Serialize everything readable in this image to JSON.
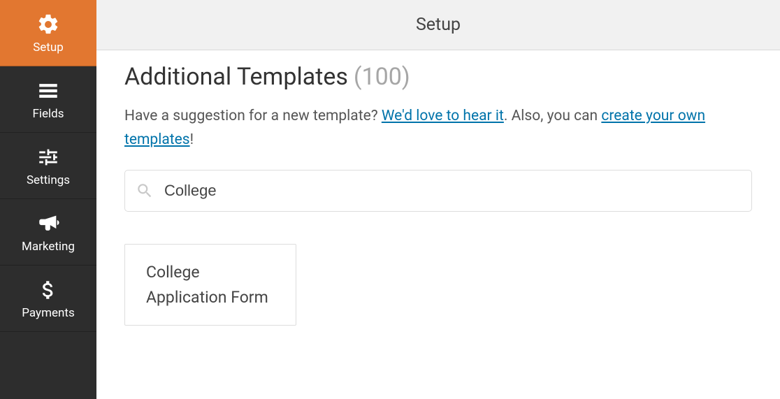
{
  "header": {
    "title": "Setup"
  },
  "sidebar": {
    "items": [
      {
        "label": "Setup"
      },
      {
        "label": "Fields"
      },
      {
        "label": "Settings"
      },
      {
        "label": "Marketing"
      },
      {
        "label": "Payments"
      }
    ]
  },
  "page": {
    "heading": "Additional Templates",
    "count_display": "(100)",
    "desc_part1": "Have a suggestion for a new template? ",
    "link1": "We'd love to hear it",
    "desc_part2": ". Also, you can ",
    "link2": "create your own templates",
    "desc_part3": "!",
    "search_value": "College",
    "templates": [
      {
        "title": "College Application Form"
      }
    ]
  }
}
